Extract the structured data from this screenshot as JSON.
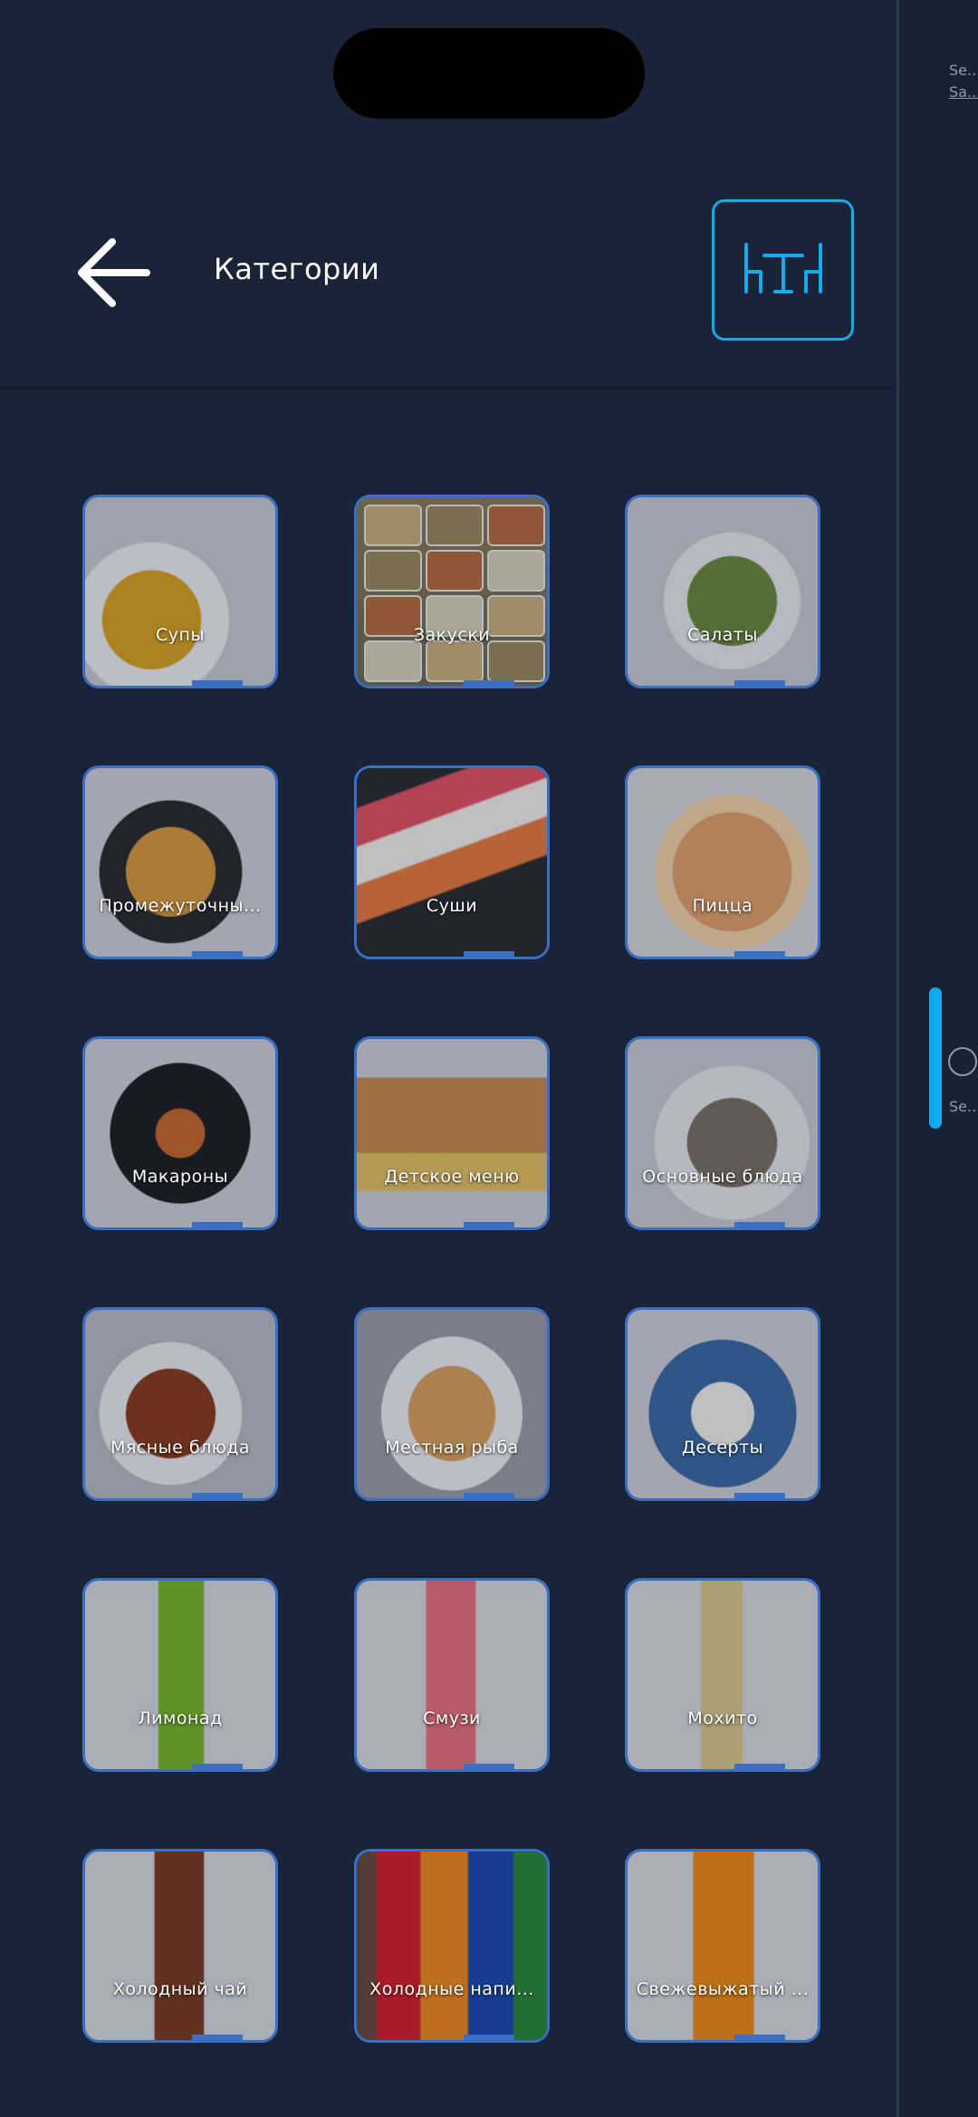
{
  "header": {
    "title": "Категории"
  },
  "side_panel": {
    "text1": "Se...",
    "text2": "Sa...",
    "text3": "Se..."
  },
  "categories": [
    {
      "label": "Супы",
      "icon": "soup-image"
    },
    {
      "label": "Закуски",
      "icon": "appetizers-image"
    },
    {
      "label": "Салаты",
      "icon": "salad-image"
    },
    {
      "label": "Промежуточны...",
      "icon": "chicken-fries-image"
    },
    {
      "label": "Суши",
      "icon": "sushi-image"
    },
    {
      "label": "Пицца",
      "icon": "pizza-image"
    },
    {
      "label": "Макароны",
      "icon": "pasta-image"
    },
    {
      "label": "Детское меню",
      "icon": "kids-burger-image"
    },
    {
      "label": "Основные блюда",
      "icon": "fish-main-image"
    },
    {
      "label": "Мясные блюда",
      "icon": "meat-image"
    },
    {
      "label": "Местная рыба",
      "icon": "local-fish-image"
    },
    {
      "label": "Десерты",
      "icon": "dessert-image"
    },
    {
      "label": "Лимонад",
      "icon": "lemonade-image"
    },
    {
      "label": "Смузи",
      "icon": "smoothie-image"
    },
    {
      "label": "Мохито",
      "icon": "mojito-image"
    },
    {
      "label": "Холодный чай",
      "icon": "iced-tea-image"
    },
    {
      "label": "Холодные напи...",
      "icon": "cold-drinks-image"
    },
    {
      "label": "Свежевыжатый ...",
      "icon": "fresh-juice-image"
    }
  ],
  "colors": {
    "background": "#1a2438",
    "accent": "#1aa7ec",
    "tile_border": "#3b6fc4"
  }
}
